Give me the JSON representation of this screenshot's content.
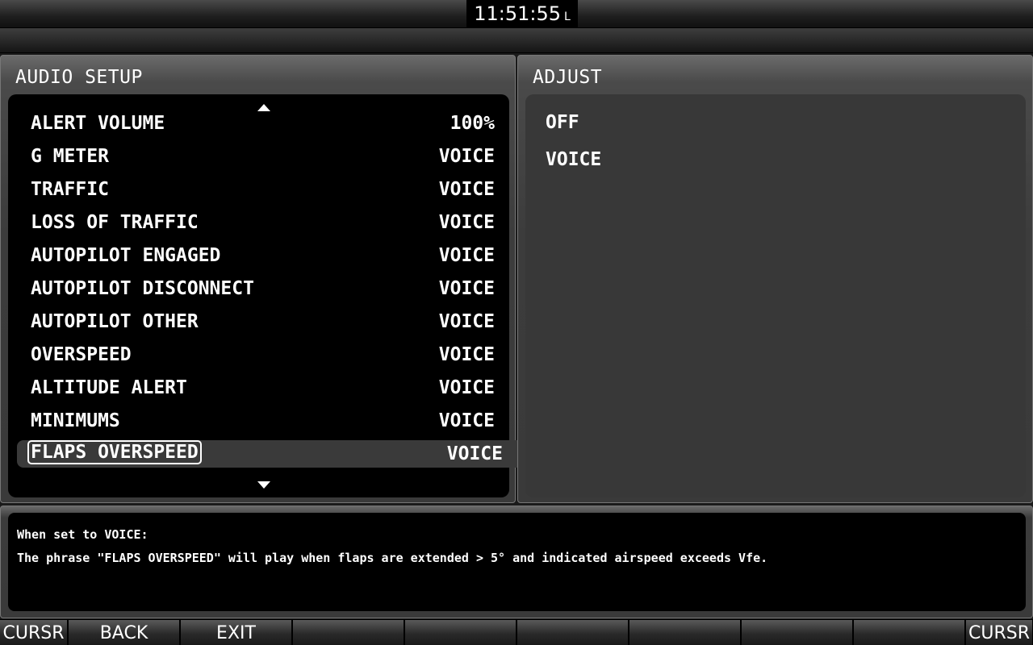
{
  "header": {
    "clock": "11:51:55",
    "clock_suffix": "L"
  },
  "audio_setup": {
    "title": "AUDIO SETUP",
    "items": [
      {
        "label": "ALERT VOLUME",
        "value": "100%"
      },
      {
        "label": "G METER",
        "value": "VOICE"
      },
      {
        "label": "TRAFFIC",
        "value": "VOICE"
      },
      {
        "label": "LOSS OF TRAFFIC",
        "value": "VOICE"
      },
      {
        "label": "AUTOPILOT ENGAGED",
        "value": "VOICE"
      },
      {
        "label": "AUTOPILOT DISCONNECT",
        "value": "VOICE"
      },
      {
        "label": "AUTOPILOT OTHER",
        "value": "VOICE"
      },
      {
        "label": "OVERSPEED",
        "value": "VOICE"
      },
      {
        "label": "ALTITUDE ALERT",
        "value": "VOICE"
      },
      {
        "label": "MINIMUMS",
        "value": "VOICE"
      },
      {
        "label": "FLAPS OVERSPEED",
        "value": "VOICE",
        "selected": true
      }
    ]
  },
  "adjust": {
    "title": "ADJUST",
    "options": [
      "OFF",
      "VOICE"
    ]
  },
  "description": {
    "line1": "When set to VOICE:",
    "line2": "The phrase \"FLAPS OVERSPEED\" will play when flaps are extended > 5° and indicated airspeed exceeds Vfe."
  },
  "softkeys": [
    "CURSR",
    "BACK",
    "EXIT",
    "",
    "",
    "",
    "",
    "",
    "",
    "CURSR"
  ],
  "colors": {
    "background": "#000000",
    "panel": "#3a3a3a",
    "text": "#ffffff",
    "selected_row": "#3a3a3a"
  }
}
